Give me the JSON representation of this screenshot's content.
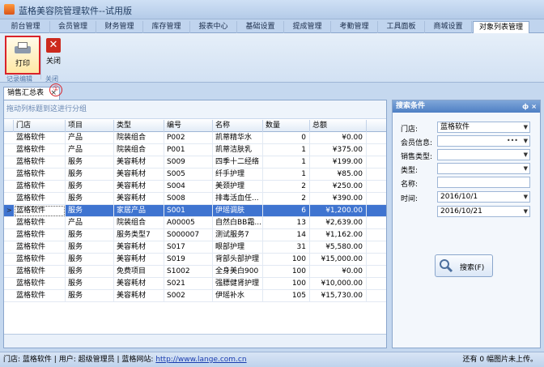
{
  "app": {
    "title": "蓝格美容院管理软件--试用版"
  },
  "tabs": [
    {
      "label": "前台管理"
    },
    {
      "label": "会员管理"
    },
    {
      "label": "财务管理"
    },
    {
      "label": "库存管理"
    },
    {
      "label": "报表中心"
    },
    {
      "label": "基础设置"
    },
    {
      "label": "提成管理"
    },
    {
      "label": "考勤管理"
    },
    {
      "label": "工具面板"
    },
    {
      "label": "商城设置"
    },
    {
      "label": "对象列表管理"
    }
  ],
  "ribbon": {
    "print_label": "打印",
    "close_label": "关闭",
    "group1_label": "记录编辑",
    "group2_label": "关闭",
    "annotation": "①"
  },
  "document_tab": {
    "label": "销售汇总表",
    "close": "×"
  },
  "grid": {
    "group_hint": "拖动列标题到这进行分组",
    "columns": [
      "门店",
      "项目",
      "类型",
      "编号",
      "名称",
      "数量",
      "总额"
    ],
    "rows": [
      [
        "蓝格软件",
        "产品",
        "院装组合",
        "P002",
        "凯蒂精华水",
        "0",
        "¥0.00"
      ],
      [
        "蓝格软件",
        "产品",
        "院装组合",
        "P001",
        "凯蒂洁肤乳",
        "1",
        "¥375.00"
      ],
      [
        "蓝格软件",
        "服务",
        "美容耗材",
        "S009",
        "四季十二经络",
        "1",
        "¥199.00"
      ],
      [
        "蓝格软件",
        "服务",
        "美容耗材",
        "S005",
        "纤手护理",
        "1",
        "¥85.00"
      ],
      [
        "蓝格软件",
        "服务",
        "美容耗材",
        "S004",
        "美颈护理",
        "2",
        "¥250.00"
      ],
      [
        "蓝格软件",
        "服务",
        "美容耗材",
        "S008",
        "排毒活血任...",
        "2",
        "¥390.00"
      ],
      [
        "蓝格软件",
        "服务",
        "家居产品",
        "S001",
        "伊瑶调肤",
        "6",
        "¥1,200.00"
      ],
      [
        "蓝格软件",
        "产品",
        "院装组合",
        "A00005",
        "自然白BB霜...",
        "13",
        "¥2,639.00"
      ],
      [
        "蓝格软件",
        "服务",
        "服务类型7",
        "S000007",
        "测试服务7",
        "14",
        "¥1,162.00"
      ],
      [
        "蓝格软件",
        "服务",
        "美容耗材",
        "S017",
        "眼部护理",
        "31",
        "¥5,580.00"
      ],
      [
        "蓝格软件",
        "服务",
        "美容耗材",
        "S019",
        "背部头部护理",
        "100",
        "¥15,000.00"
      ],
      [
        "蓝格软件",
        "服务",
        "免费项目",
        "S1002",
        "全身美白900",
        "100",
        "¥0.00"
      ],
      [
        "蓝格软件",
        "服务",
        "美容耗材",
        "S021",
        "强膘健肾护理",
        "100",
        "¥10,000.00"
      ],
      [
        "蓝格软件",
        "服务",
        "美容耗材",
        "S002",
        "伊瑶补水",
        "105",
        "¥15,730.00"
      ]
    ],
    "selected_row": 6,
    "selected_indicator": ">"
  },
  "search_panel": {
    "title": "搜索条件",
    "pin": "ф",
    "close": "×",
    "fields": [
      {
        "label": "门店:",
        "value": "蓝格软件"
      },
      {
        "label": "会员信息:",
        "value": ""
      },
      {
        "label": "销售类型:",
        "value": ""
      },
      {
        "label": "类型:",
        "value": ""
      },
      {
        "label": "名称:",
        "value": ""
      },
      {
        "label": "时间:",
        "value": "2016/10/1"
      },
      {
        "label": "",
        "value": "2016/10/21"
      }
    ],
    "search_button": "搜索(F)"
  },
  "status": {
    "store_label": "门店:",
    "store_value": "蓝格软件",
    "user_label": "用户:",
    "user_value": "超级管理员",
    "site_label": "蓝格网站:",
    "site_url": "http://www.lange.com.cn",
    "right_text": "还有 0 幅图片未上传。"
  },
  "colors": {
    "accent": "#3f74d0",
    "annotation": "#d9232a"
  }
}
